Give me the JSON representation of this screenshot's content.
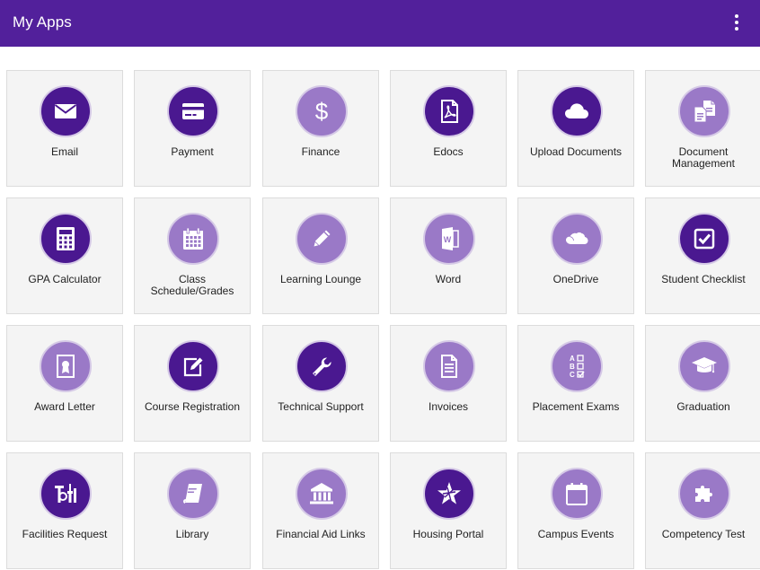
{
  "header": {
    "title": "My Apps",
    "menu_icon": "more-vert-icon"
  },
  "colors": {
    "header_bg": "#52209b",
    "icon_dark": "#4a1890",
    "icon_light": "#9a79c7",
    "tile_bg": "#f4f4f4"
  },
  "apps": [
    {
      "label": "Email",
      "icon": "email-icon"
    },
    {
      "label": "Payment",
      "icon": "credit-card-icon"
    },
    {
      "label": "Finance",
      "icon": "dollar-icon"
    },
    {
      "label": "Edocs",
      "icon": "pdf-icon"
    },
    {
      "label": "Upload Documents",
      "icon": "cloud-icon"
    },
    {
      "label": "Document Management",
      "icon": "documents-icon"
    },
    {
      "label": "GPA Calculator",
      "icon": "calculator-icon"
    },
    {
      "label": "Class Schedule/Grades",
      "icon": "calendar-icon"
    },
    {
      "label": "Learning Lounge",
      "icon": "pencil-icon"
    },
    {
      "label": "Word",
      "icon": "word-icon"
    },
    {
      "label": "OneDrive",
      "icon": "onedrive-icon"
    },
    {
      "label": "Student Checklist",
      "icon": "checkbox-icon"
    },
    {
      "label": "Award Letter",
      "icon": "certificate-icon"
    },
    {
      "label": "Course Registration",
      "icon": "edit-icon"
    },
    {
      "label": "Technical Support",
      "icon": "wrench-icon"
    },
    {
      "label": "Invoices",
      "icon": "invoice-icon"
    },
    {
      "label": "Placement Exams",
      "icon": "abc-test-icon"
    },
    {
      "label": "Graduation",
      "icon": "graduation-cap-icon"
    },
    {
      "label": "Facilities Request",
      "icon": "tools-icon"
    },
    {
      "label": "Library",
      "icon": "book-icon"
    },
    {
      "label": "Financial Aid Links",
      "icon": "bank-icon"
    },
    {
      "label": "Housing Portal",
      "icon": "star-logo-icon"
    },
    {
      "label": "Campus Events",
      "icon": "calendar-blank-icon"
    },
    {
      "label": "Competency Test",
      "icon": "puzzle-icon"
    }
  ]
}
